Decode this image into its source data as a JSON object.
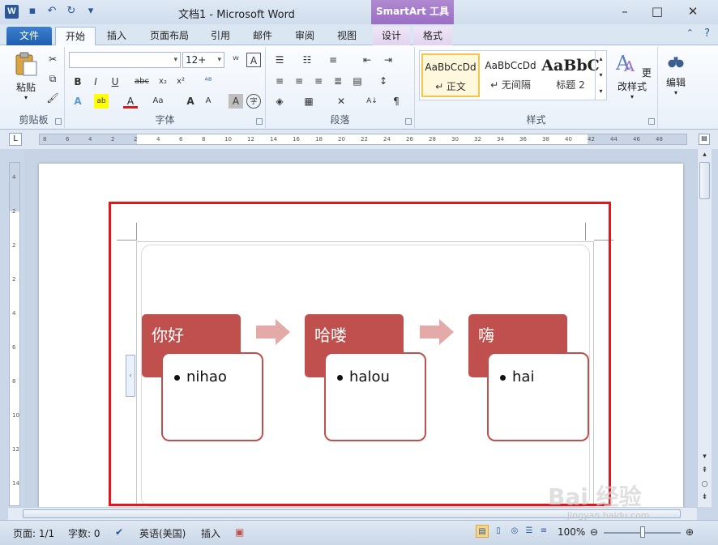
{
  "window": {
    "title": "文档1 - Microsoft Word",
    "contextual_tab_group": "SmartArt 工具",
    "app_icon": "W"
  },
  "tabs": [
    {
      "label": "文件",
      "kind": "file"
    },
    {
      "label": "开始",
      "kind": "active"
    },
    {
      "label": "插入",
      "kind": "normal"
    },
    {
      "label": "页面布局",
      "kind": "normal"
    },
    {
      "label": "引用",
      "kind": "normal"
    },
    {
      "label": "邮件",
      "kind": "normal"
    },
    {
      "label": "审阅",
      "kind": "normal"
    },
    {
      "label": "视图",
      "kind": "normal"
    },
    {
      "label": "设计",
      "kind": "contextual"
    },
    {
      "label": "格式",
      "kind": "contextual"
    }
  ],
  "ribbon": {
    "clipboard": {
      "label": "剪贴板",
      "paste": "粘贴"
    },
    "font": {
      "label": "字体",
      "font_name": "",
      "font_size": "12+"
    },
    "paragraph": {
      "label": "段落"
    },
    "styles": {
      "label": "样式",
      "items": [
        {
          "sample": "AaBbCcDd",
          "name": "↵ 正文",
          "selected": true
        },
        {
          "sample": "AaBbCcDd",
          "name": "↵ 无间隔",
          "selected": false
        },
        {
          "sample": "AaBbC",
          "name": "标题 2",
          "selected": false
        }
      ],
      "change_styles": "更改样式"
    },
    "editing": {
      "label": "编辑"
    }
  },
  "ruler": {
    "h_ticks": [
      "8",
      "6",
      "4",
      "2",
      "2",
      "4",
      "6",
      "8",
      "10",
      "12",
      "14",
      "16",
      "18",
      "20",
      "22",
      "24",
      "26",
      "28",
      "30",
      "32",
      "34",
      "36",
      "38",
      "40",
      "42",
      "44",
      "46",
      "48"
    ],
    "v_ticks": [
      "4",
      "2",
      "2",
      "2",
      "4",
      "6",
      "8",
      "10",
      "12",
      "14"
    ]
  },
  "smartart": {
    "colors": {
      "accent": "#c0504d",
      "arrow": "#e3aaa8"
    },
    "nodes": [
      {
        "heading": "你好",
        "bullet": "nihao"
      },
      {
        "heading": "哈喽",
        "bullet": "halou"
      },
      {
        "heading": "嗨",
        "bullet": "hai"
      }
    ]
  },
  "statusbar": {
    "page": "页面: 1/1",
    "words": "字数: 0",
    "language": "英语(美国)",
    "mode": "插入",
    "zoom": "100%"
  },
  "watermark": {
    "main": "Bai 经验",
    "sub": "jingyan.baidu.com"
  }
}
